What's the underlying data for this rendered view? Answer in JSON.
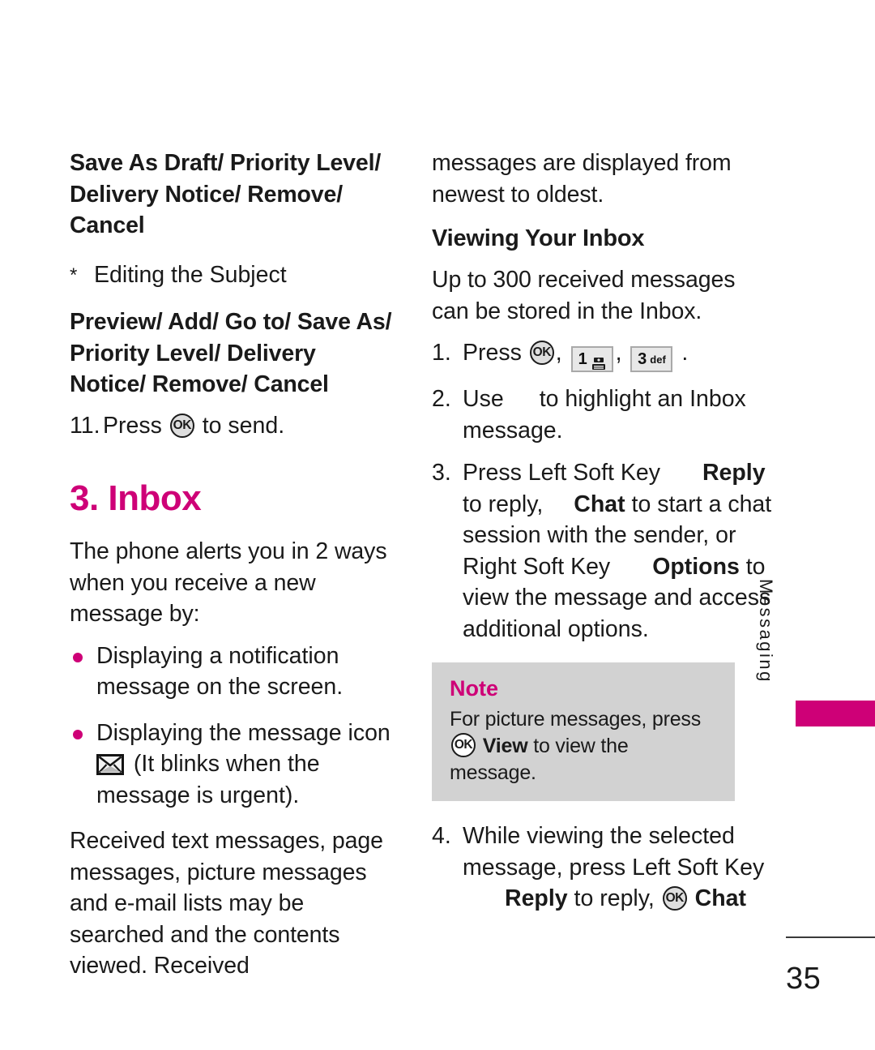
{
  "page": {
    "number": "35",
    "side_tab_label": "Messaging",
    "accent_color": "#CE0077",
    "note_bg_color": "#D2D2D2"
  },
  "left_column": {
    "options_line_1": "Save As Draft/ Priority Level/ Delivery Notice/ Remove/ Cancel",
    "star_item": {
      "marker": "*",
      "text": "Editing the Subject"
    },
    "options_line_2": "Preview/ Add/ Go to/ Save As/ Priority Level/ Delivery Notice/ Remove/ Cancel",
    "step_11": {
      "number": "11.",
      "text_before": "Press",
      "key": "OK",
      "text_after": "to send."
    },
    "section_heading": "3. Inbox",
    "intro": "The phone alerts you in 2 ways when you receive a new message by:",
    "bullets": [
      {
        "text": "Displaying a notification message on the screen."
      },
      {
        "icon": "envelope-icon",
        "text_before": "Displaying the message icon",
        "text_after": "(It blinks when the message is urgent)."
      }
    ],
    "closing": "Received text messages, page messages, picture messages and e-mail lists may be searched and the contents viewed. Received"
  },
  "right_column": {
    "continued": "messages are displayed from newest to oldest.",
    "sub_heading": "Viewing Your Inbox",
    "capacity": "Up to 300 received messages can be stored in the Inbox.",
    "step_1": {
      "number": "1.",
      "text_before": "Press",
      "keys": [
        {
          "name": "ok-key",
          "digit": "OK"
        },
        {
          "name": "key-1",
          "digit": "1",
          "sublabel": "",
          "glyph": "voicemail-icon"
        },
        {
          "name": "key-3",
          "digit": "3",
          "sublabel": "def"
        }
      ],
      "text_after": "."
    },
    "step_2": {
      "number": "2.",
      "text_before": "Use",
      "text_after": "to highlight an Inbox message."
    },
    "step_3": {
      "number": "3.",
      "part_a": "Press Left Soft Key",
      "bold_reply": "Reply",
      "part_b": "to reply,",
      "bold_chat": "Chat",
      "part_c": "to start a chat session with the sender, or Right Soft Key",
      "bold_options": "Options",
      "part_d": "to view the message and access additional options."
    },
    "note": {
      "title": "Note",
      "text_before": "For picture messages, press",
      "key": "OK",
      "bold_view": "View",
      "text_after": "to view the message."
    },
    "step_4": {
      "number": "4.",
      "part_a": "While viewing the selected message, press Left Soft Key",
      "bold_reply": "Reply",
      "part_b": "to reply,",
      "key": "OK",
      "bold_chat": "Chat"
    }
  }
}
